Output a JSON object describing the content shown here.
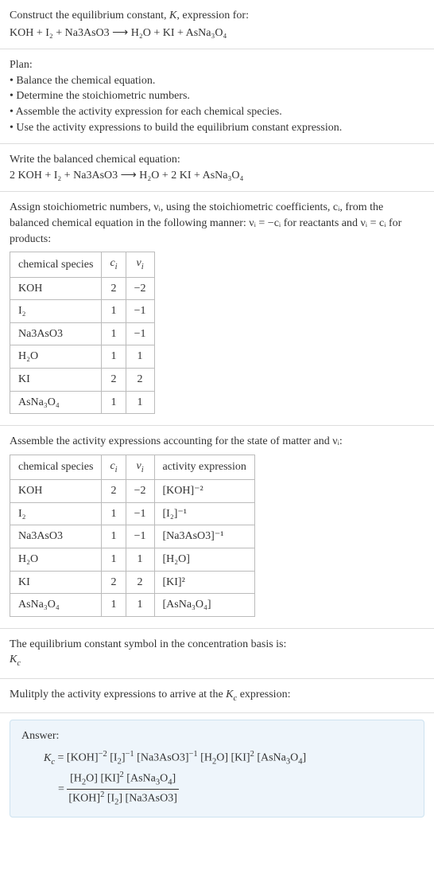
{
  "header": {
    "line1": "Construct the equilibrium constant, K, expression for:",
    "equation": "KOH + I₂ + Na3AsO3  ⟶  H₂O + KI + AsNa₃O₄"
  },
  "plan": {
    "title": "Plan:",
    "items": [
      "Balance the chemical equation.",
      "Determine the stoichiometric numbers.",
      "Assemble the activity expression for each chemical species.",
      "Use the activity expressions to build the equilibrium constant expression."
    ]
  },
  "balanced": {
    "title": "Write the balanced chemical equation:",
    "equation": "2 KOH + I₂ + Na3AsO3  ⟶  H₂O + 2 KI + AsNa₃O₄"
  },
  "stoich_intro": "Assign stoichiometric numbers, νᵢ, using the stoichiometric coefficients, cᵢ, from the balanced chemical equation in the following manner: νᵢ = −cᵢ for reactants and νᵢ = cᵢ for products:",
  "stoich_table": {
    "headers": [
      "chemical species",
      "cᵢ",
      "νᵢ"
    ],
    "rows": [
      {
        "species": "KOH",
        "c": "2",
        "v": "−2"
      },
      {
        "species": "I₂",
        "c": "1",
        "v": "−1"
      },
      {
        "species": "Na3AsO3",
        "c": "1",
        "v": "−1"
      },
      {
        "species": "H₂O",
        "c": "1",
        "v": "1"
      },
      {
        "species": "KI",
        "c": "2",
        "v": "2"
      },
      {
        "species": "AsNa₃O₄",
        "c": "1",
        "v": "1"
      }
    ]
  },
  "activity_intro": "Assemble the activity expressions accounting for the state of matter and νᵢ:",
  "activity_table": {
    "headers": [
      "chemical species",
      "cᵢ",
      "νᵢ",
      "activity expression"
    ],
    "rows": [
      {
        "species": "KOH",
        "c": "2",
        "v": "−2",
        "expr": "[KOH]⁻²"
      },
      {
        "species": "I₂",
        "c": "1",
        "v": "−1",
        "expr": "[I₂]⁻¹"
      },
      {
        "species": "Na3AsO3",
        "c": "1",
        "v": "−1",
        "expr": "[Na3AsO3]⁻¹"
      },
      {
        "species": "H₂O",
        "c": "1",
        "v": "1",
        "expr": "[H₂O]"
      },
      {
        "species": "KI",
        "c": "2",
        "v": "2",
        "expr": "[KI]²"
      },
      {
        "species": "AsNa₃O₄",
        "c": "1",
        "v": "1",
        "expr": "[AsNa₃O₄]"
      }
    ]
  },
  "kc_symbol": {
    "line1": "The equilibrium constant symbol in the concentration basis is:",
    "symbol": "K_c"
  },
  "multiply": "Mulitply the activity expressions to arrive at the K_c expression:",
  "answer": {
    "label": "Answer:",
    "line1": "K_c = [KOH]⁻² [I₂]⁻¹ [Na3AsO3]⁻¹ [H₂O] [KI]² [AsNa₃O₄]",
    "eq_prefix": "= ",
    "frac_num": "[H₂O] [KI]² [AsNa₃O₄]",
    "frac_den": "[KOH]² [I₂] [Na3AsO3]"
  },
  "chart_data": {
    "type": "table",
    "tables": [
      {
        "title": "Stoichiometric numbers",
        "columns": [
          "chemical species",
          "c_i",
          "ν_i"
        ],
        "rows": [
          [
            "KOH",
            2,
            -2
          ],
          [
            "I2",
            1,
            -1
          ],
          [
            "Na3AsO3",
            1,
            -1
          ],
          [
            "H2O",
            1,
            1
          ],
          [
            "KI",
            2,
            2
          ],
          [
            "AsNa3O4",
            1,
            1
          ]
        ]
      },
      {
        "title": "Activity expressions",
        "columns": [
          "chemical species",
          "c_i",
          "ν_i",
          "activity expression"
        ],
        "rows": [
          [
            "KOH",
            2,
            -2,
            "[KOH]^-2"
          ],
          [
            "I2",
            1,
            -1,
            "[I2]^-1"
          ],
          [
            "Na3AsO3",
            1,
            -1,
            "[Na3AsO3]^-1"
          ],
          [
            "H2O",
            1,
            1,
            "[H2O]"
          ],
          [
            "KI",
            2,
            2,
            "[KI]^2"
          ],
          [
            "AsNa3O4",
            1,
            1,
            "[AsNa3O4]"
          ]
        ]
      }
    ]
  }
}
